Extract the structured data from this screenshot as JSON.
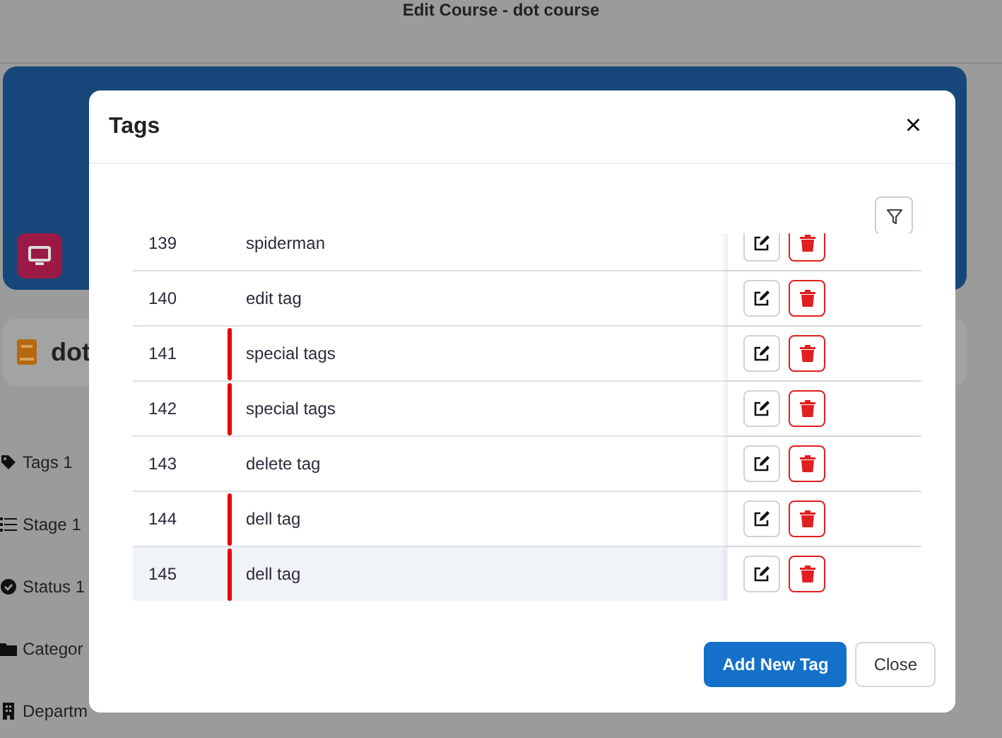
{
  "page": {
    "title": "Edit Course - dot course",
    "course_name": "dot",
    "fields": [
      {
        "kind": "tags",
        "label": "Tags 1"
      },
      {
        "kind": "stage",
        "label": "Stage 1"
      },
      {
        "kind": "status",
        "label": "Status 1"
      },
      {
        "kind": "category",
        "label": "Categor"
      },
      {
        "kind": "department",
        "label": "Departm"
      }
    ]
  },
  "modal": {
    "title": "Tags",
    "close": "×",
    "rows": [
      {
        "id": "139",
        "name": "spiderman",
        "selected": false,
        "marked": false
      },
      {
        "id": "140",
        "name": "edit tag",
        "selected": false,
        "marked": false
      },
      {
        "id": "141",
        "name": "special tags",
        "selected": false,
        "marked": true
      },
      {
        "id": "142",
        "name": "special tags",
        "selected": false,
        "marked": true
      },
      {
        "id": "143",
        "name": "delete tag",
        "selected": false,
        "marked": false
      },
      {
        "id": "144",
        "name": "dell tag",
        "selected": false,
        "marked": true
      },
      {
        "id": "145",
        "name": "dell tag",
        "selected": true,
        "marked": true
      }
    ],
    "buttons": [
      {
        "kind": "primary",
        "label": "Add New Tag"
      },
      {
        "kind": "secondary",
        "label": "Close"
      }
    ]
  }
}
